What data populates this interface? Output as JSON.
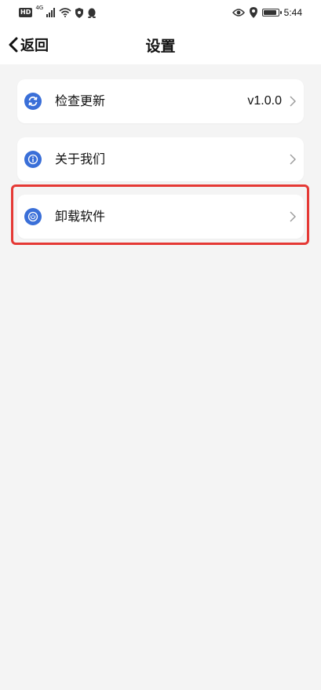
{
  "status_bar": {
    "hd": "HD",
    "network": "4G",
    "time": "5:44"
  },
  "header": {
    "back_label": "返回",
    "title": "设置"
  },
  "settings": [
    {
      "label": "检查更新",
      "value": "v1.0.0",
      "icon": "refresh-icon"
    },
    {
      "label": "关于我们",
      "value": "",
      "icon": "info-icon"
    },
    {
      "label": "卸载软件",
      "value": "",
      "icon": "power-icon",
      "highlighted": true
    }
  ],
  "colors": {
    "icon_blue": "#3a6fd8",
    "highlight_red": "#e53935",
    "page_background": "#f4f4f4"
  }
}
